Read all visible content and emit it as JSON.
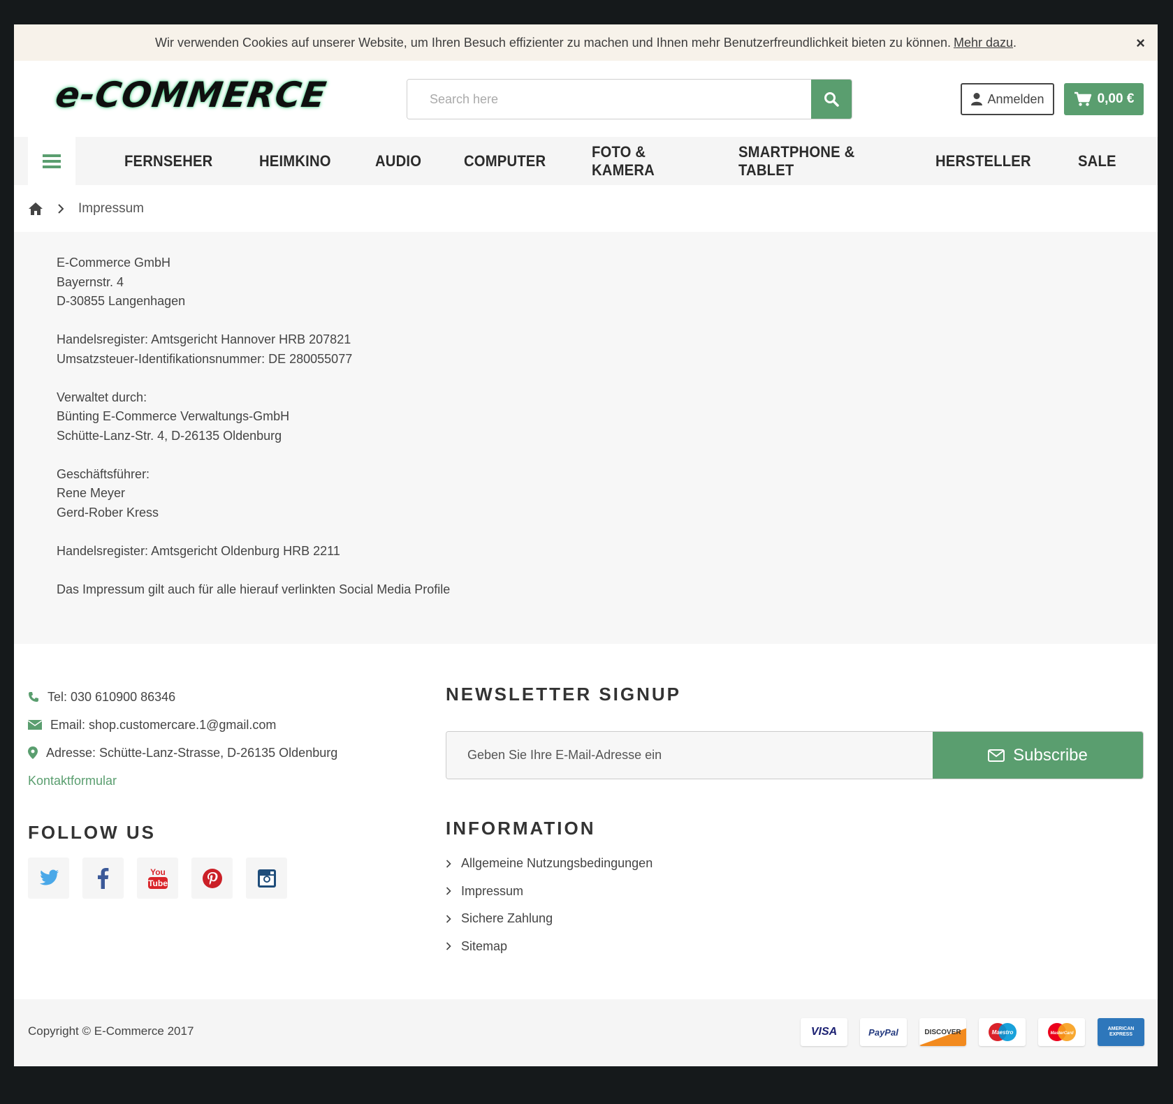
{
  "cookie": {
    "text": "Wir verwenden Cookies auf unserer Website, um Ihren Besuch effizienter zu machen und Ihnen mehr Benutzerfreundlichkeit bieten zu können.",
    "link": "Mehr dazu",
    "suffix": ".",
    "close": "×"
  },
  "header": {
    "logo": "e-COMMERCE",
    "search_placeholder": "Search here",
    "login": "Anmelden",
    "cart_total": "0,00 €"
  },
  "nav": {
    "items": [
      "FERNSEHER",
      "HEIMKINO",
      "AUDIO",
      "COMPUTER",
      "FOTO & KAMERA",
      "SMARTPHONE & TABLET",
      "HERSTELLER",
      "SALE"
    ]
  },
  "breadcrumb": {
    "current": "Impressum"
  },
  "content": {
    "lines": [
      "E-Commerce GmbH",
      "Bayernstr. 4",
      "D-30855 Langenhagen",
      "",
      "Handelsregister: Amtsgericht Hannover HRB 207821",
      "Umsatzsteuer-Identifikationsnummer: DE 280055077",
      "",
      "Verwaltet durch:",
      "Bünting E-Commerce Verwaltungs-GmbH",
      "Schütte-Lanz-Str. 4, D-26135 Oldenburg",
      "",
      "Geschäftsführer:",
      "Rene Meyer",
      "Gerd-Rober Kress",
      "",
      "Handelsregister: Amtsgericht Oldenburg HRB 2211",
      "",
      "Das Impressum gilt auch für alle hierauf verlinkten Social Media Profile"
    ]
  },
  "footer": {
    "tel": "Tel: 030 610900 86346",
    "email": "Email: shop.customercare.1@gmail.com",
    "address": "Adresse: Schütte-Lanz-Strasse, D-26135 Oldenburg",
    "contact_form": "Kontaktformular",
    "follow_title": "FOLLOW US",
    "newsletter_title": "NEWSLETTER SIGNUP",
    "newsletter_placeholder": "Geben Sie Ihre E-Mail-Adresse ein",
    "subscribe": "Subscribe",
    "info_title": "INFORMATION",
    "info_links": [
      "Allgemeine Nutzungsbedingungen",
      "Impressum",
      "Sichere Zahlung",
      "Sitemap"
    ],
    "copyright": "Copyright © E-Commerce 2017",
    "social": [
      "twitter-icon",
      "facebook-icon",
      "youtube-icon",
      "pinterest-icon",
      "instagram-icon"
    ],
    "payments": [
      "VISA",
      "PayPal",
      "DISCOVER",
      "Maestro",
      "MasterCard",
      "AMERICAN EXPRESS"
    ]
  },
  "colors": {
    "accent": "#5a9e6f",
    "frame": "#15191b"
  }
}
